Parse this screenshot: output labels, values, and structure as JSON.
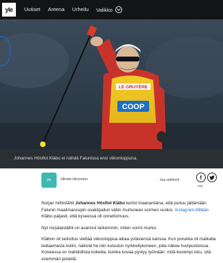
{
  "nav": {
    "logo": "yle",
    "items": [
      "Uutiset",
      "Areena",
      "Urheilu"
    ],
    "menu_label": "Valikko"
  },
  "hero": {
    "caption": "Johannes Hösflot Kläbo ei nähdä Falunissa ensi viikonloppuna.",
    "bib_sponsor_top": "LE GRUYÈRE",
    "bib_sponsor_main": "COOP"
  },
  "author": {
    "avatar_text": "yle",
    "name": "Himmi Hirvonen",
    "share_label": "Jaa artikkeli:",
    "share_count": "255"
  },
  "article": {
    "p1_prefix": "Norjan hiihtotähti ",
    "p1_name": "Johannes Hösflot Kläbo",
    "p1_rest": " kertoi maanantaina, että joutuu jättämään Falunin maailmancupin osakilpailun väliin murtuneen sormen vuoksi. ",
    "p1_link": "Instagram-tilillään",
    "p1_end": " Kläbo paljasti, että kyseessä oli onnettomuus.",
    "p2": "Nyt norjalaistähti on avannut tarkemmin, miten sormi murtui.",
    "p3": "Kläbon oli tarkoitus viettää viikonloppua aikaa ystäviensä kanssa. Kun porukka oli matkalla keilaamasta kotiin, näkivät he niin kutsutun nyrkkeilykoneen, joita näkee huvipuistoissa. Koneessa on mahdollista kokeilla, kuinka kovaa pystyy lyömään: mitä kovempi isku, sitä enemmän pisteitä."
  }
}
